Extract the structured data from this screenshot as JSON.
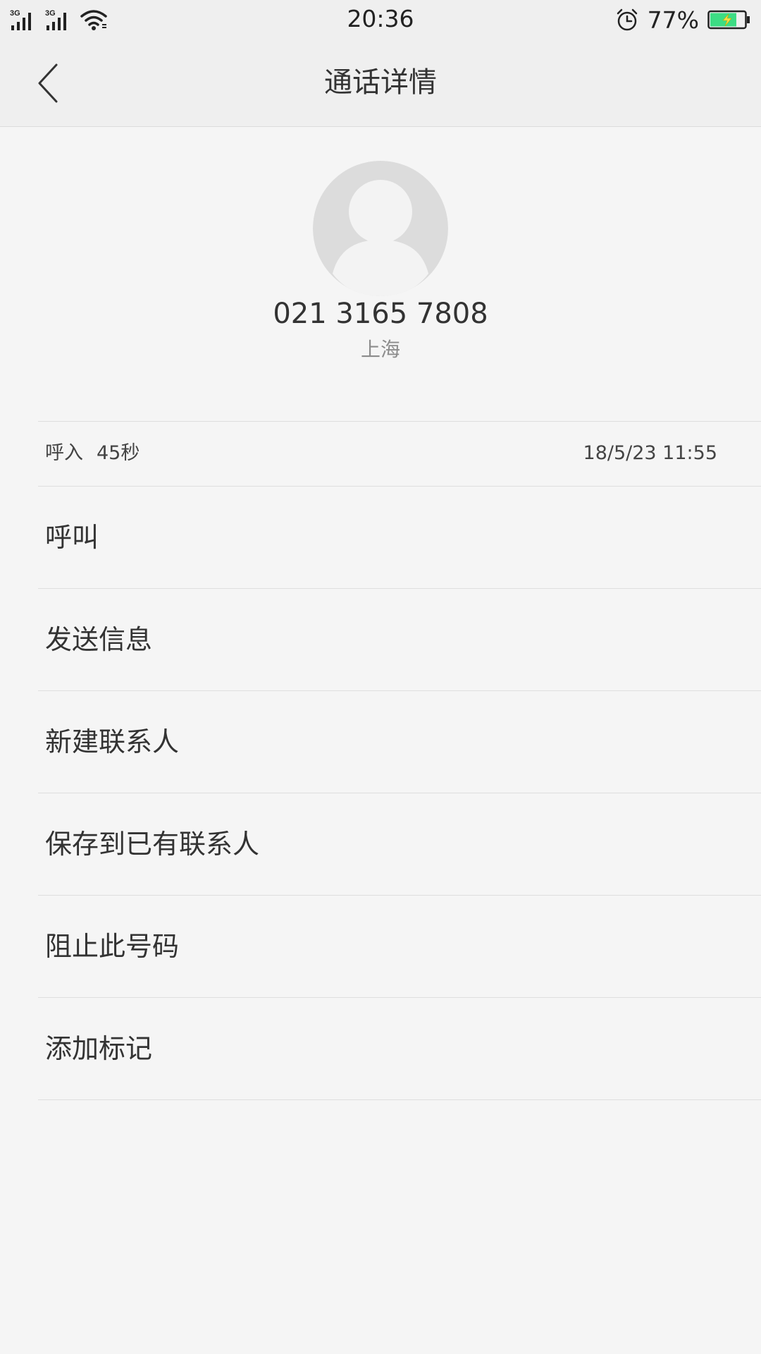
{
  "status_bar": {
    "time": "20:36",
    "battery_percent_text": "77%",
    "battery_level": 0.77,
    "signal_1_label": "3G",
    "signal_2_label": "3G",
    "icons": [
      "signal-icon",
      "wifi-icon",
      "alarm-icon",
      "battery-charging-icon"
    ],
    "battery_color": "#3ddc84"
  },
  "nav": {
    "title": "通话详情",
    "back_icon": "chevron-left-icon"
  },
  "contact": {
    "avatar_icon": "default-avatar-icon",
    "number": "021 3165 7808",
    "location": "上海"
  },
  "call_record": {
    "type": "呼入",
    "duration": "45秒",
    "datetime": "18/5/23 11:55"
  },
  "actions": [
    {
      "label": "呼叫"
    },
    {
      "label": "发送信息"
    },
    {
      "label": "新建联系人"
    },
    {
      "label": "保存到已有联系人"
    },
    {
      "label": "阻止此号码"
    },
    {
      "label": "添加标记"
    }
  ]
}
